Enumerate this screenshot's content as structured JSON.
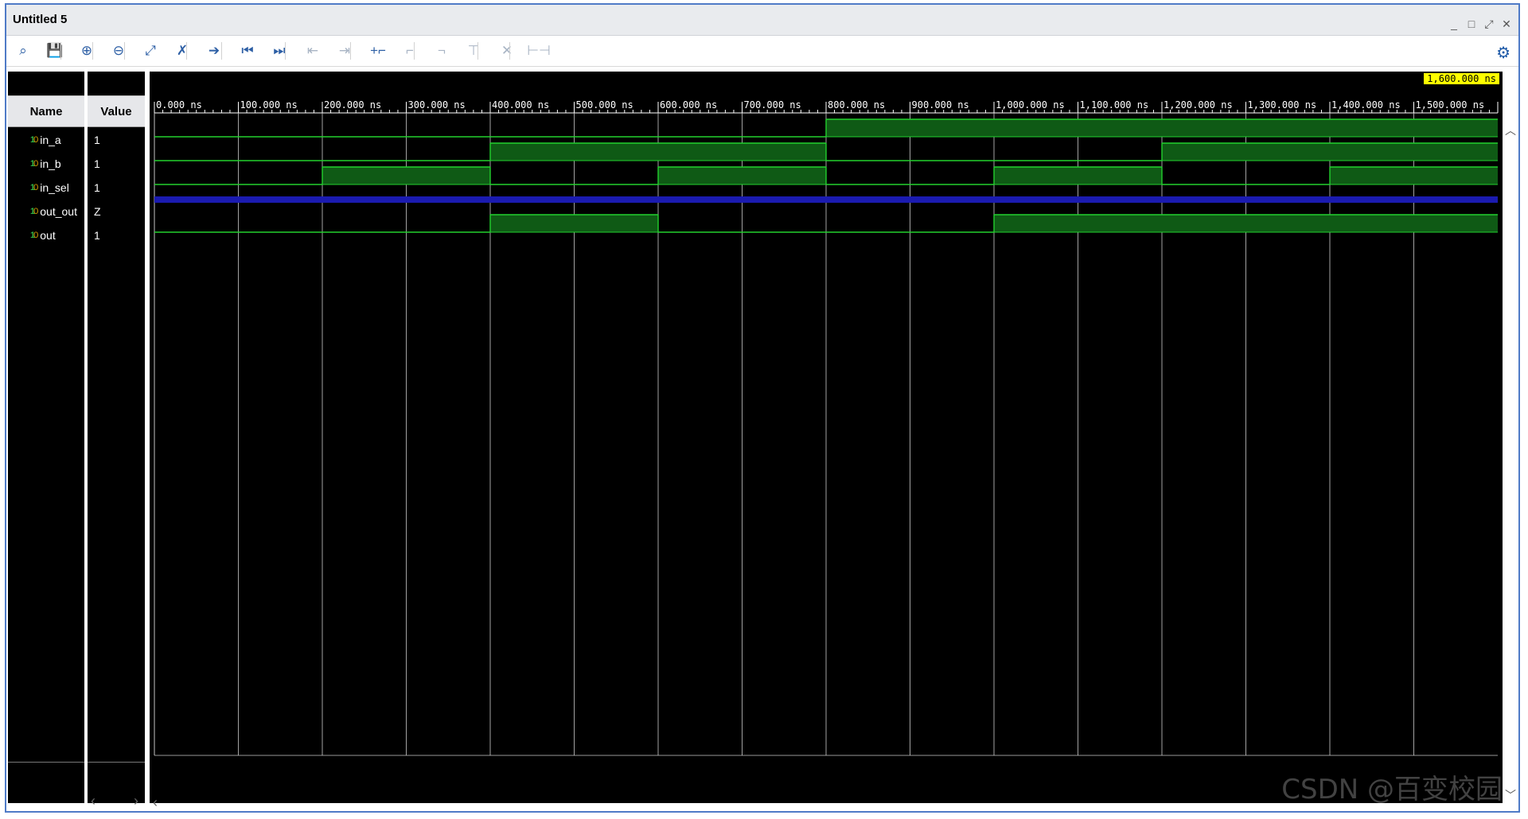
{
  "window": {
    "title": "Untitled 5"
  },
  "window_controls": [
    "_",
    "□",
    "⤢",
    "✕"
  ],
  "toolbar": {
    "buttons": [
      {
        "name": "search-icon",
        "glyph": "⌕",
        "enabled": true
      },
      {
        "name": "save-icon",
        "glyph": "💾",
        "enabled": true
      },
      {
        "name": "zoom-in-icon",
        "glyph": "⊕",
        "enabled": true
      },
      {
        "name": "zoom-out-icon",
        "glyph": "⊖",
        "enabled": true
      },
      {
        "name": "zoom-fit-icon",
        "glyph": "⤢",
        "enabled": true
      },
      {
        "name": "zoom-to-cursor-icon",
        "glyph": "✗",
        "enabled": true
      },
      {
        "name": "go-to-cursor-icon",
        "glyph": "➔",
        "enabled": true
      },
      {
        "name": "go-to-time-zero-icon",
        "glyph": "⏮",
        "enabled": true
      },
      {
        "name": "go-to-last-time-icon",
        "glyph": "⏭",
        "enabled": true
      },
      {
        "name": "previous-transition-icon",
        "glyph": "⇤",
        "enabled": false
      },
      {
        "name": "next-transition-icon",
        "glyph": "⇥",
        "enabled": false
      },
      {
        "name": "add-marker-icon",
        "glyph": "+⌐",
        "enabled": true
      },
      {
        "name": "previous-marker-icon",
        "glyph": "⌐",
        "enabled": false
      },
      {
        "name": "next-marker-icon",
        "glyph": "¬",
        "enabled": false
      },
      {
        "name": "swap-cursors-icon",
        "glyph": "⊤",
        "enabled": false
      },
      {
        "name": "delete-marker-icon",
        "glyph": "✕",
        "enabled": false
      },
      {
        "name": "snap-icon",
        "glyph": "⊢⊣",
        "enabled": false
      }
    ],
    "settings_icon": "gear-icon"
  },
  "columns": {
    "name_header": "Name",
    "value_header": "Value"
  },
  "signals": [
    {
      "name": "in_a",
      "value": "1",
      "icon": "bit-signal-icon"
    },
    {
      "name": "in_b",
      "value": "1",
      "icon": "bit-signal-icon"
    },
    {
      "name": "in_sel",
      "value": "1",
      "icon": "bit-signal-icon"
    },
    {
      "name": "out_out",
      "value": "Z",
      "icon": "bit-signal-icon"
    },
    {
      "name": "out",
      "value": "1",
      "icon": "bit-signal-icon"
    }
  ],
  "cursor_time": "1,600.000 ns",
  "watermark": "CSDN @百变校园",
  "colors": {
    "wave_bg": "#000000",
    "wave_high_fill": "#0f5a15",
    "wave_line": "#22d12e",
    "z_state": "#1b1bb0",
    "grid": "#cccccc",
    "cursor_bg": "#ffff00"
  },
  "chart_data": {
    "type": "timing",
    "x_unit": "ns",
    "x_range": [
      0,
      1600
    ],
    "time_labels": [
      "0.000 ns",
      "100.000 ns",
      "200.000 ns",
      "300.000 ns",
      "400.000 ns",
      "500.000 ns",
      "600.000 ns",
      "700.000 ns",
      "800.000 ns",
      "900.000 ns",
      "1,000.000 ns",
      "1,100.000 ns",
      "1,200.000 ns",
      "1,300.000 ns",
      "1,400.000 ns",
      "1,500.000 ns"
    ],
    "series": [
      {
        "name": "in_a",
        "segments": [
          [
            0,
            800,
            "0"
          ],
          [
            800,
            1600,
            "1"
          ]
        ]
      },
      {
        "name": "in_b",
        "segments": [
          [
            0,
            400,
            "0"
          ],
          [
            400,
            800,
            "1"
          ],
          [
            800,
            1200,
            "0"
          ],
          [
            1200,
            1600,
            "1"
          ]
        ]
      },
      {
        "name": "in_sel",
        "segments": [
          [
            0,
            200,
            "0"
          ],
          [
            200,
            400,
            "1"
          ],
          [
            400,
            600,
            "0"
          ],
          [
            600,
            800,
            "1"
          ],
          [
            800,
            1000,
            "0"
          ],
          [
            1000,
            1200,
            "1"
          ],
          [
            1200,
            1400,
            "0"
          ],
          [
            1400,
            1600,
            "1"
          ]
        ]
      },
      {
        "name": "out_out",
        "segments": [
          [
            0,
            1600,
            "Z"
          ]
        ]
      },
      {
        "name": "out",
        "segments": [
          [
            0,
            400,
            "0"
          ],
          [
            400,
            600,
            "1"
          ],
          [
            600,
            1000,
            "0"
          ],
          [
            1000,
            1600,
            "1"
          ]
        ]
      }
    ]
  }
}
